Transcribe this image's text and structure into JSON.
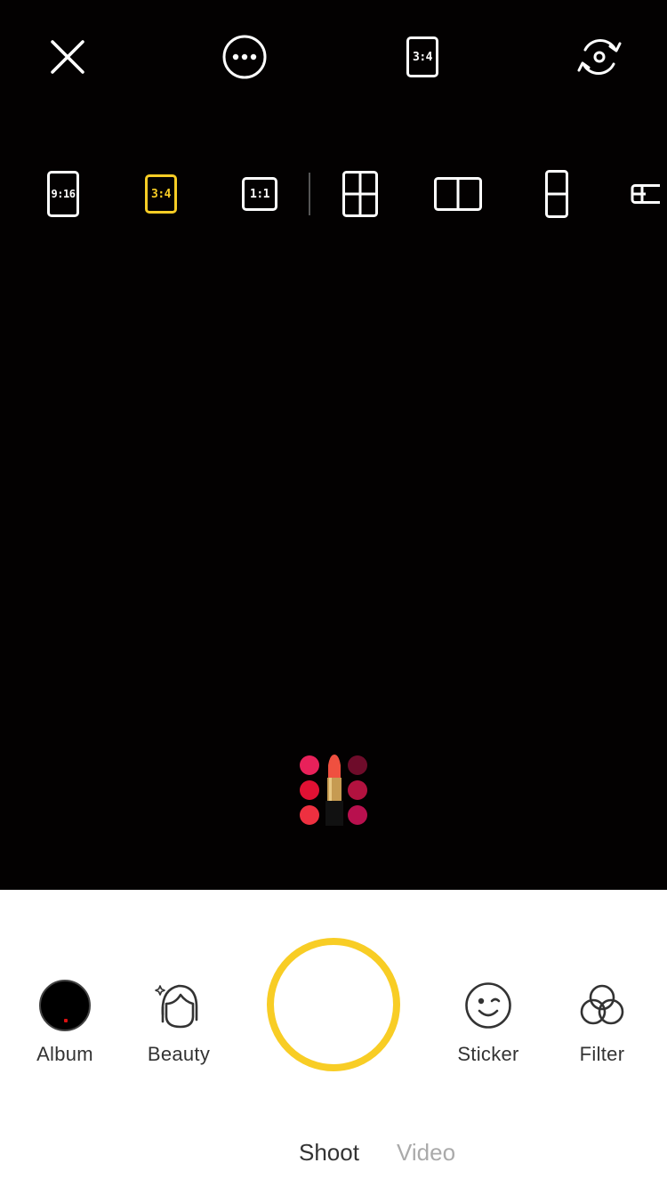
{
  "top_bar": {
    "close_icon": "close-icon",
    "more_icon": "more-dots-icon",
    "current_ratio": "3:4",
    "switch_camera_icon": "switch-camera-icon"
  },
  "layouts": {
    "ratios": [
      {
        "label": "9:16",
        "selected": false
      },
      {
        "label": "3:4",
        "selected": true
      },
      {
        "label": "1:1",
        "selected": false
      }
    ],
    "grids": [
      {
        "icon": "grid-2x2-icon"
      },
      {
        "icon": "grid-2-horizontal-icon"
      },
      {
        "icon": "grid-2-vertical-icon"
      },
      {
        "icon": "grid-partial-icon"
      }
    ]
  },
  "sticker_preview": {
    "icon": "lipstick-palette-icon"
  },
  "tools": {
    "album": "Album",
    "beauty": "Beauty",
    "sticker": "Sticker",
    "filter": "Filter"
  },
  "modes": {
    "shoot": "Shoot",
    "video": "Video",
    "active": "shoot"
  },
  "colors": {
    "accent": "#f8cd25",
    "viewfinder_bg": "#030101",
    "panel_bg": "#ffffff",
    "text_primary": "#333333",
    "text_inactive": "#aaaaaa"
  }
}
